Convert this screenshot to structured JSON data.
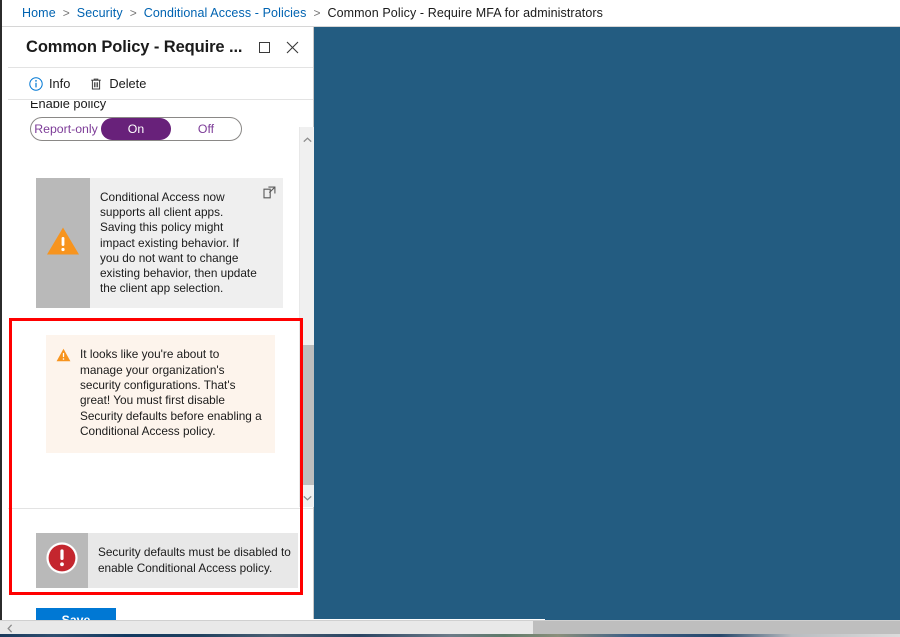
{
  "breadcrumb": {
    "items": [
      {
        "label": "Home",
        "current": false
      },
      {
        "label": "Security",
        "current": false
      },
      {
        "label": "Conditional Access - Policies",
        "current": false
      },
      {
        "label": "Common Policy - Require MFA for administrators",
        "current": true
      }
    ],
    "separator": ">"
  },
  "blade": {
    "title": "Common Policy - Require ...",
    "maximize_icon": "maximize-icon",
    "close_icon": "close-icon",
    "commands": [
      {
        "label": "Info",
        "icon": "info-circle-icon"
      },
      {
        "label": "Delete",
        "icon": "trash-icon"
      }
    ]
  },
  "form": {
    "enable_policy_label": "Enable policy",
    "toggle": {
      "options": [
        {
          "label": "Report-only",
          "selected": false
        },
        {
          "label": "On",
          "selected": true
        },
        {
          "label": "Off",
          "selected": false
        }
      ],
      "selected_value": "On"
    }
  },
  "info_banner": {
    "icon": "warning-triangle-icon",
    "external_link_icon": "external-link-icon",
    "text": "Conditional Access now supports all client apps. Saving this policy might impact existing behavior. If you do not want to change existing behavior, then update the client app selection."
  },
  "peach_callout": {
    "icon": "warning-triangle-icon",
    "text": "It looks like you're about to manage your organization's security configurations. That's great! You must first disable Security defaults before enabling a Conditional Access policy."
  },
  "error_banner": {
    "icon": "error-circle-icon",
    "text": "Security defaults must be disabled to enable Conditional Access policy."
  },
  "footer": {
    "save_label": "Save"
  },
  "scrollbars": {
    "vertical": {
      "up_arrow_icon": "chevron-up-icon",
      "down_arrow_icon": "chevron-down-icon"
    },
    "horizontal": {
      "left_arrow_icon": "chevron-left-icon"
    }
  },
  "colors": {
    "accent_blue": "#0078d4",
    "breadcrumb_link": "#0063b1",
    "backdrop_blue": "#235c81",
    "toggle_selected": "#68217a",
    "toggle_text": "#7d3c98",
    "warning_orange": "#f7941e",
    "error_red": "#c4262e",
    "highlight_red": "#ff0000",
    "peach_bg": "#fdf4ec",
    "banner_gray": "#efefef",
    "banner_icon_gray": "#b9b9b9"
  }
}
